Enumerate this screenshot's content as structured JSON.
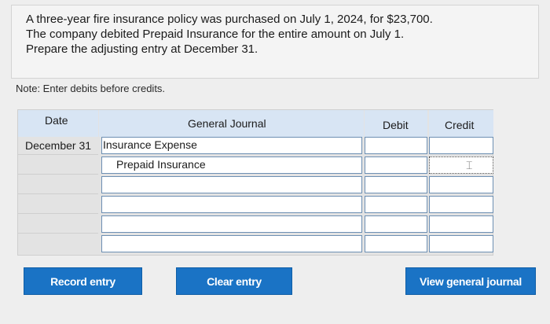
{
  "question": {
    "lines": [
      "A three-year fire insurance policy was purchased on July 1, 2024, for $23,700.",
      "The company debited Prepaid Insurance for the entire amount on July 1.",
      "Prepare the adjusting entry at December 31."
    ]
  },
  "note": "Note: Enter debits before credits.",
  "journal": {
    "headers": {
      "date": "Date",
      "general_journal": "General Journal",
      "debit": "Debit",
      "credit": "Credit"
    },
    "rows": [
      {
        "date": "December 31",
        "account": "Insurance Expense",
        "debit": "",
        "credit": ""
      },
      {
        "date": "",
        "account": "Prepaid Insurance",
        "debit": "",
        "credit": ""
      },
      {
        "date": "",
        "account": "",
        "debit": "",
        "credit": ""
      },
      {
        "date": "",
        "account": "",
        "debit": "",
        "credit": ""
      },
      {
        "date": "",
        "account": "",
        "debit": "",
        "credit": ""
      },
      {
        "date": "",
        "account": "",
        "debit": "",
        "credit": ""
      }
    ]
  },
  "buttons": {
    "record": "Record entry",
    "clear": "Clear entry",
    "view": "View general journal"
  },
  "colors": {
    "header_bg": "#d8e5f4",
    "button_bg": "#1a73c5",
    "cell_border": "#6d8fb3"
  }
}
